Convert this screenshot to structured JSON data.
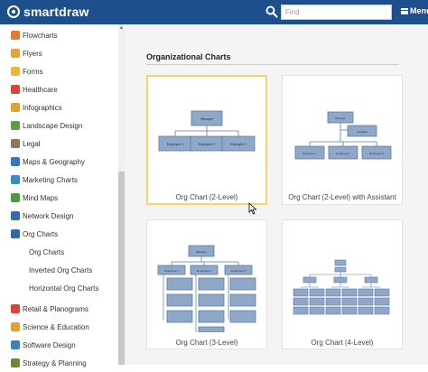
{
  "header": {
    "brand": "smartdraw",
    "search_placeholder": "Find",
    "menu_label": "Menu"
  },
  "sidebar": {
    "items": [
      {
        "label": "Flowcharts",
        "icon": "flowchart-icon",
        "color": "#e07a2f"
      },
      {
        "label": "Flyers",
        "icon": "flyer-icon",
        "color": "#e8a23a"
      },
      {
        "label": "Forms",
        "icon": "form-icon",
        "color": "#f0b53c"
      },
      {
        "label": "Healthcare",
        "icon": "healthcare-icon",
        "color": "#d9453b"
      },
      {
        "label": "Infographics",
        "icon": "infographic-icon",
        "color": "#e0a032"
      },
      {
        "label": "Landscape Design",
        "icon": "landscape-icon",
        "color": "#5aa043"
      },
      {
        "label": "Legal",
        "icon": "legal-icon",
        "color": "#8a7a5a"
      },
      {
        "label": "Maps & Geography",
        "icon": "map-icon",
        "color": "#2e79c0"
      },
      {
        "label": "Marketing Charts",
        "icon": "marketing-chart-icon",
        "color": "#3a8bd0"
      },
      {
        "label": "Mind Maps",
        "icon": "mind-map-icon",
        "color": "#4c9a3e"
      },
      {
        "label": "Network Design",
        "icon": "network-icon",
        "color": "#2f6fae"
      },
      {
        "label": "Org Charts",
        "icon": "org-chart-icon",
        "color": "#2d6aa8"
      }
    ],
    "sub_items": [
      {
        "label": "Org Charts"
      },
      {
        "label": "Inverted Org Charts"
      },
      {
        "label": "Horizontal Org Charts"
      }
    ],
    "more_items": [
      {
        "label": "Retail & Planograms",
        "icon": "retail-icon",
        "color": "#d9453b"
      },
      {
        "label": "Science & Education",
        "icon": "science-icon",
        "color": "#e0a032"
      },
      {
        "label": "Software Design",
        "icon": "software-icon",
        "color": "#3a7fc0"
      },
      {
        "label": "Strategy & Planning",
        "icon": "strategy-icon",
        "color": "#6a8a3a"
      }
    ]
  },
  "main": {
    "section_title": "Organizational Charts",
    "cards": [
      {
        "caption": "Org Chart (2-Level)",
        "selected": true,
        "nodes": {
          "manager": "Manager",
          "employees": [
            "Employee 1",
            "Employee 2",
            "Employee 3"
          ]
        }
      },
      {
        "caption": "Org Chart (2-Level) with Assistant",
        "selected": false,
        "nodes": {
          "manager": "Manager",
          "assistant": "Assistant",
          "employees": [
            "Employee 1",
            "Employee 2",
            "Employee 3"
          ]
        }
      },
      {
        "caption": "Org Chart (3-Level)",
        "selected": false,
        "nodes": {
          "manager": "Manager",
          "employees": [
            "Employee 1",
            "Employee 2",
            "Employee 3"
          ]
        }
      },
      {
        "caption": "Org Chart (4-Level)",
        "selected": false
      }
    ]
  },
  "colors": {
    "topbar": "#1c4f8c",
    "node_fill": "#8fa8c8",
    "node_stroke": "#5a7aa0",
    "selected_border": "#f2d66a"
  }
}
